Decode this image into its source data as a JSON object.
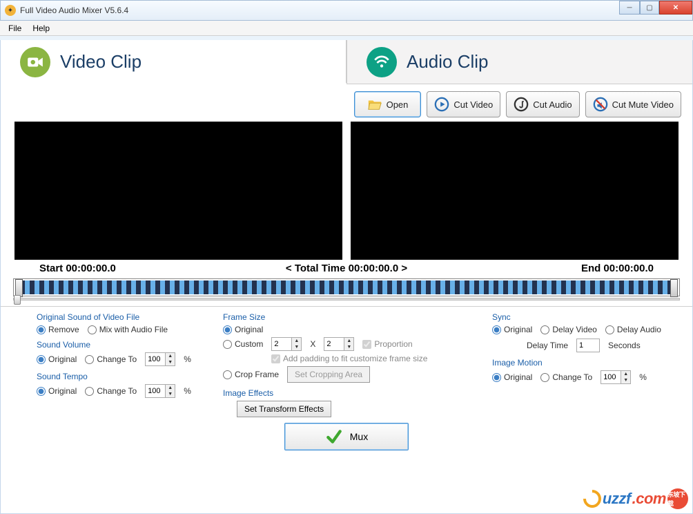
{
  "window": {
    "title": "Full Video Audio Mixer V5.6.4"
  },
  "menu": {
    "file": "File",
    "help": "Help"
  },
  "tabs": {
    "video": "Video Clip",
    "audio": "Audio Clip"
  },
  "toolbar": {
    "open": "Open",
    "cut_video": "Cut Video",
    "cut_audio": "Cut Audio",
    "cut_mute": "Cut Mute Video"
  },
  "time": {
    "start_label": "Start 00:00:00.0",
    "total_label": "< Total Time 00:00:00.0 >",
    "end_label": "End 00:00:00.0"
  },
  "sound_file": {
    "label": "Original Sound of Video File",
    "remove": "Remove",
    "mix": "Mix with Audio File"
  },
  "volume": {
    "label": "Sound Volume",
    "original": "Original",
    "change_to": "Change To",
    "value": "100",
    "pct": "%"
  },
  "tempo": {
    "label": "Sound Tempo",
    "original": "Original",
    "change_to": "Change To",
    "value": "100",
    "pct": "%"
  },
  "frame": {
    "label": "Frame Size",
    "original": "Original",
    "custom": "Custom",
    "w": "2",
    "x": "X",
    "h": "2",
    "proportion": "Proportion",
    "padding": "Add padding to fit customize frame size",
    "crop": "Crop Frame",
    "crop_btn": "Set Cropping Area"
  },
  "effects": {
    "label": "Image Effects",
    "btn": "Set Transform Effects"
  },
  "sync": {
    "label": "Sync",
    "original": "Original",
    "delay_video": "Delay Video",
    "delay_audio": "Delay Audio",
    "time_label": "Delay Time",
    "time_value": "1",
    "seconds": "Seconds"
  },
  "motion": {
    "label": "Image Motion",
    "original": "Original",
    "change_to": "Change To",
    "value": "100",
    "pct": "%"
  },
  "mux": {
    "label": "Mux"
  },
  "watermark": {
    "text": "uzzf",
    "ext": ".com",
    "badge": "东坡下载"
  }
}
